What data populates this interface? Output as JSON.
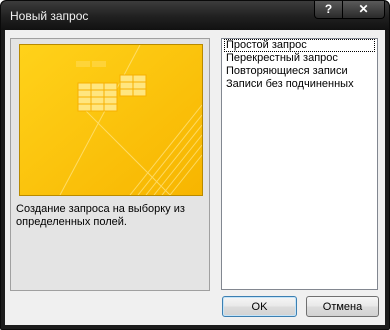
{
  "window": {
    "title": "Новый запрос",
    "help_label": "?",
    "close_label": "✕"
  },
  "preview": {
    "description": "Создание запроса на выборку из определенных полей."
  },
  "query_types": [
    {
      "label": "Простой запрос",
      "selected": true
    },
    {
      "label": "Перекрестный запрос",
      "selected": false
    },
    {
      "label": "Повторяющиеся записи",
      "selected": false
    },
    {
      "label": "Записи без подчиненных",
      "selected": false
    }
  ],
  "buttons": {
    "ok_label": "OK",
    "cancel_label": "Отмена"
  },
  "colors": {
    "preview_bg": "#ffcc10",
    "titlebar": "#202020"
  }
}
